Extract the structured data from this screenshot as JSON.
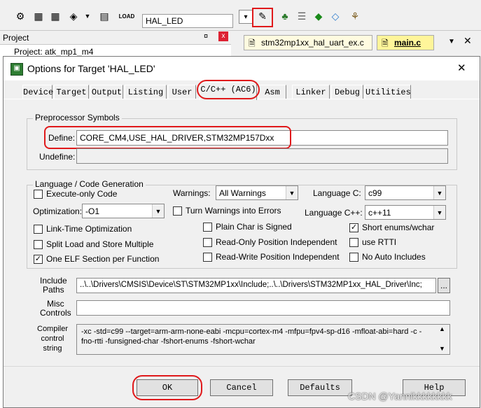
{
  "toolbar": {
    "target_select": "HAL_LED",
    "load_icon_label": "LOAD"
  },
  "project_pane": {
    "title": "Project",
    "pin": "¤",
    "close": "x",
    "tree_root": "Project: atk_mp1_m4"
  },
  "editor": {
    "tabs": [
      {
        "label": "stm32mp1xx_hal_uart_ex.c"
      },
      {
        "label": "main.c"
      }
    ]
  },
  "dialog": {
    "title": "Options for Target 'HAL_LED'",
    "close": "✕",
    "tabs": [
      {
        "label": "Device"
      },
      {
        "label": "Target"
      },
      {
        "label": "Output"
      },
      {
        "label": "Listing"
      },
      {
        "label": "User"
      },
      {
        "label": "C/C++ (AC6)"
      },
      {
        "label": "Asm"
      },
      {
        "label": "Linker"
      },
      {
        "label": "Debug"
      },
      {
        "label": "Utilities"
      }
    ],
    "preprocessor": {
      "group_label": "Preprocessor Symbols",
      "define_label": "Define:",
      "define_value": "CORE_CM4,USE_HAL_DRIVER,STM32MP157Dxx",
      "undefine_label": "Undefine:",
      "undefine_value": ""
    },
    "language": {
      "group_label": "Language / Code Generation",
      "execute_only": "Execute-only Code",
      "warnings_label": "Warnings:",
      "warnings_value": "All Warnings",
      "language_c_label": "Language C:",
      "language_c_value": "c99",
      "optimization_label": "Optimization:",
      "optimization_value": "-O1",
      "turn_warnings": "Turn Warnings into Errors",
      "language_cpp_label": "Language C++:",
      "language_cpp_value": "c++11",
      "lto": "Link-Time Optimization",
      "plain_char": "Plain Char is Signed",
      "short_enums": "Short enums/wchar",
      "split_load": "Split Load and Store Multiple",
      "ro_pi": "Read-Only Position Independent",
      "use_rtti": "use RTTI",
      "one_elf": "One ELF Section per Function",
      "rw_pi": "Read-Write Position Independent",
      "no_auto_includes": "No Auto Includes"
    },
    "include_paths_label": "Include\nPaths",
    "include_paths_value": "..\\..\\Drivers\\CMSIS\\Device\\ST\\STM32MP1xx\\Include;..\\..\\Drivers\\STM32MP1xx_HAL_Driver\\Inc;",
    "browse_label": "...",
    "misc_controls_label": "Misc\nControls",
    "misc_controls_value": "",
    "compiler_label": "Compiler\ncontrol\nstring",
    "compiler_value": "-xc -std=c99 --target=arm-arm-none-eabi -mcpu=cortex-m4 -mfpu=fpv4-sp-d16 -mfloat-abi=hard -c -fno-rtti -funsigned-char -fshort-enums -fshort-wchar",
    "buttons": {
      "ok": "OK",
      "cancel": "Cancel",
      "defaults": "Defaults",
      "help": "Help"
    }
  },
  "watermark": "CSDN @Yannikkkkkkkk",
  "colors": {
    "highlight": "#e0191b"
  }
}
